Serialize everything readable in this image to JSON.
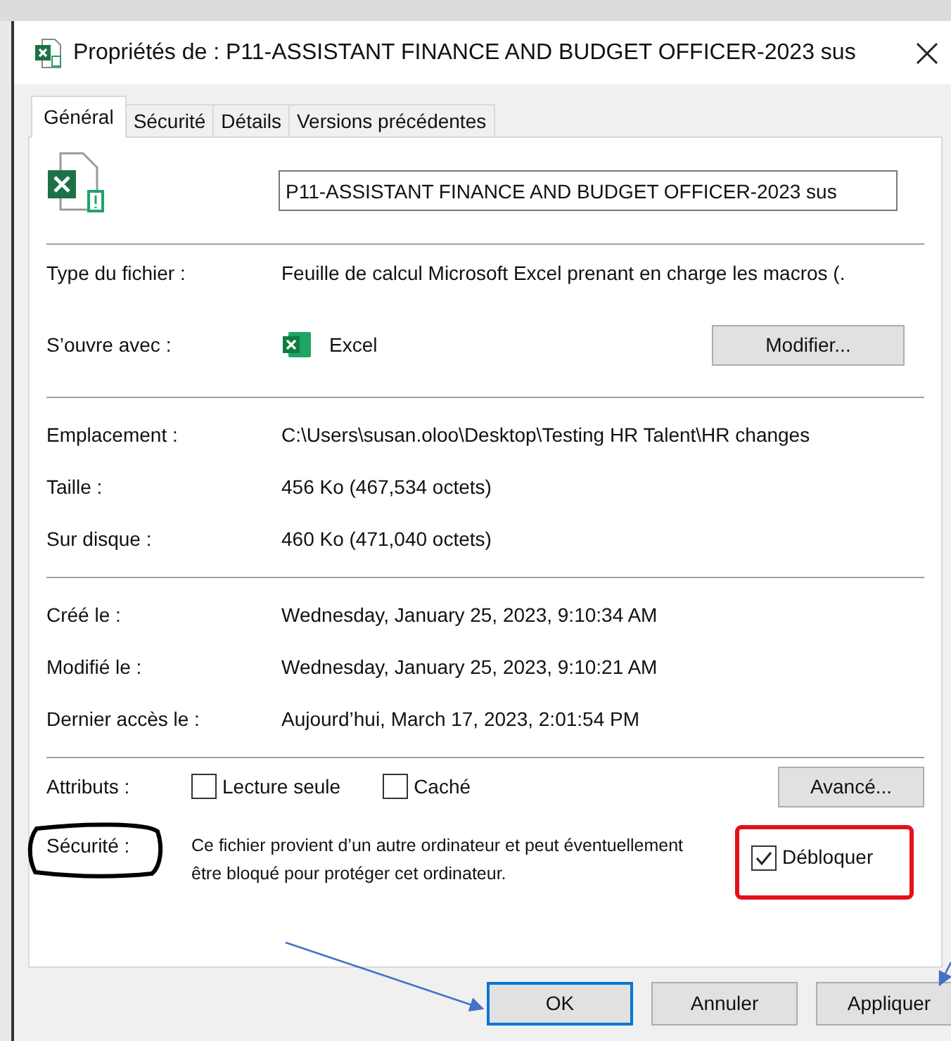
{
  "window": {
    "title": "Propriétés de : P11-ASSISTANT FINANCE AND BUDGET OFFICER-2023 sus"
  },
  "tabs": [
    {
      "label": "Général",
      "selected": true
    },
    {
      "label": "Sécurité",
      "selected": false
    },
    {
      "label": "Détails",
      "selected": false
    },
    {
      "label": "Versions précédentes",
      "selected": false
    }
  ],
  "file_name": "P11-ASSISTANT FINANCE AND BUDGET OFFICER-2023 sus",
  "type_row": {
    "label": "Type du fichier :",
    "value": "Feuille de calcul Microsoft Excel prenant en charge les macros (."
  },
  "opens_with": {
    "label": "S’ouvre avec :",
    "value": "Excel",
    "button": "Modifier..."
  },
  "groups": [
    [
      {
        "label": "Emplacement :",
        "value": "C:\\Users\\susan.oloo\\Desktop\\Testing HR Talent\\HR changes"
      },
      {
        "label": "Taille :",
        "value": "456 Ko (467,534 octets)"
      },
      {
        "label": "Sur disque :",
        "value": "460 Ko (471,040 octets)"
      }
    ],
    [
      {
        "label": "Créé le :",
        "value": "Wednesday, January 25, 2023, 9:10:34 AM"
      },
      {
        "label": "Modifié le :",
        "value": "Wednesday, January 25, 2023, 9:10:21 AM"
      },
      {
        "label": "Dernier accès le :",
        "value": "Aujourd’hui, March 17, 2023, 2:01:54 PM"
      }
    ]
  ],
  "attributes": {
    "label": "Attributs :",
    "options": [
      {
        "label": "Lecture seule",
        "checked": false
      },
      {
        "label": "Caché",
        "checked": false
      }
    ],
    "button": "Avancé..."
  },
  "security": {
    "label": "Sécurité :",
    "text": "Ce fichier provient d’un autre ordinateur et peut éventuellement être bloqué pour protéger cet ordinateur.",
    "unblock": {
      "label": "Débloquer",
      "checked": true
    }
  },
  "buttons": [
    {
      "label": "OK",
      "focused": true
    },
    {
      "label": "Annuler",
      "focused": false
    },
    {
      "label": "Appliquer",
      "focused": false
    }
  ]
}
